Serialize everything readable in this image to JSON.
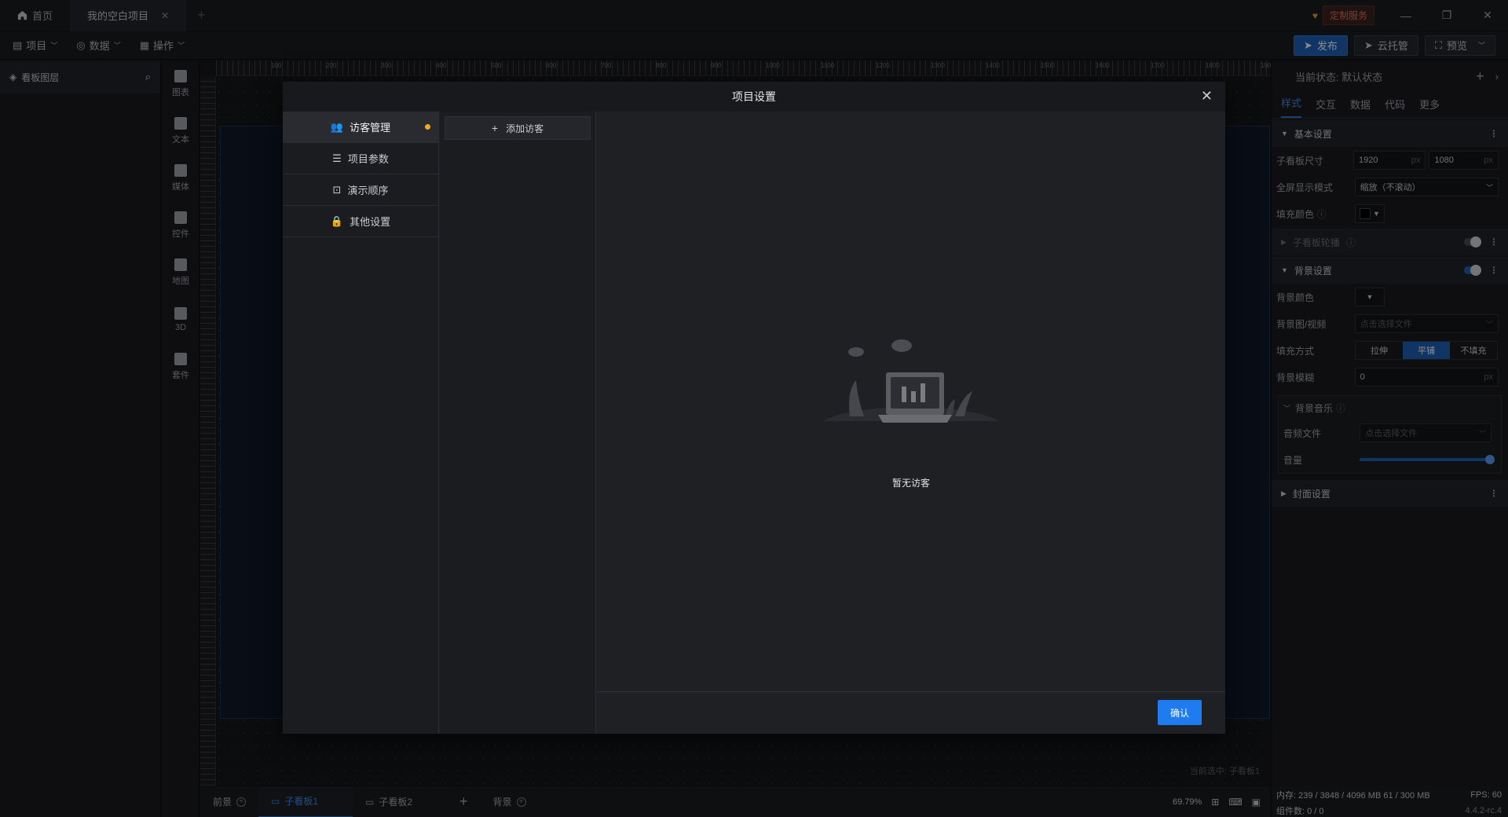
{
  "titlebar": {
    "tabs": [
      {
        "label": "首页",
        "icon": "home-icon"
      },
      {
        "label": "我的空白项目",
        "icon": ""
      }
    ],
    "custom_service": "定制服务"
  },
  "menubar": {
    "items": [
      "项目",
      "数据",
      "操作"
    ],
    "publish": "发布",
    "cloud": "云托管",
    "preview": "预览"
  },
  "layers": {
    "title": "看板图层"
  },
  "components": [
    "图表",
    "文本",
    "媒体",
    "控件",
    "地图",
    "3D",
    "套件"
  ],
  "canvas": {
    "current_selection": "当前选中: 子看板1",
    "ruler_top": [
      "100",
      "200",
      "300",
      "400",
      "500",
      "600",
      "700",
      "800",
      "900",
      "1000",
      "1100",
      "1200",
      "1300",
      "1400",
      "1500",
      "1600",
      "1700",
      "1800",
      "1900"
    ]
  },
  "bottombar": {
    "front": "前景",
    "boards": [
      "子看板1",
      "子看板2"
    ],
    "back": "背景",
    "zoom": "69.79%"
  },
  "rightpanel": {
    "state_label": "当前状态: 默认状态",
    "tabs": [
      "样式",
      "交互",
      "数据",
      "代码",
      "更多"
    ],
    "basic": {
      "title": "基本设置",
      "size_label": "子看板尺寸",
      "width": "1920",
      "height": "1080",
      "unit": "px",
      "fullscreen_label": "全屏显示模式",
      "fullscreen_value": "缩放（不滚动）",
      "fill_label": "填充颜色"
    },
    "carousel": {
      "title": "子看板轮播"
    },
    "background": {
      "title": "背景设置",
      "color_label": "背景颜色",
      "media_label": "背景图/视频",
      "media_placeholder": "点击选择文件",
      "fill_mode_label": "填充方式",
      "fill_modes": [
        "拉伸",
        "平铺",
        "不填充"
      ],
      "blur_label": "背景模糊",
      "blur_value": "0",
      "unit": "px"
    },
    "music": {
      "title": "背景音乐",
      "file_label": "音频文件",
      "file_placeholder": "点击选择文件",
      "volume_label": "音量",
      "volume": 1.0
    },
    "cover": {
      "title": "封面设置"
    }
  },
  "status": {
    "memory": "内存: 239 / 3848 / 4096 MB  61 / 300 MB",
    "fps": "FPS: 60",
    "components": "组件数: 0 / 0",
    "version": "4.4.2-rc.4"
  },
  "modal": {
    "title": "项目设置",
    "nav": [
      {
        "label": "访客管理",
        "icon": "visitors-icon"
      },
      {
        "label": "项目参数",
        "icon": "sliders-icon"
      },
      {
        "label": "演示顺序",
        "icon": "presentation-icon"
      },
      {
        "label": "其他设置",
        "icon": "lock-icon"
      }
    ],
    "add_visitor": "添加访客",
    "empty_text": "暂无访客",
    "confirm": "确认"
  },
  "colors": {
    "accent": "#1f7cf0",
    "notice_dot": "#f5a623",
    "custom_service": "#e26d5a"
  }
}
